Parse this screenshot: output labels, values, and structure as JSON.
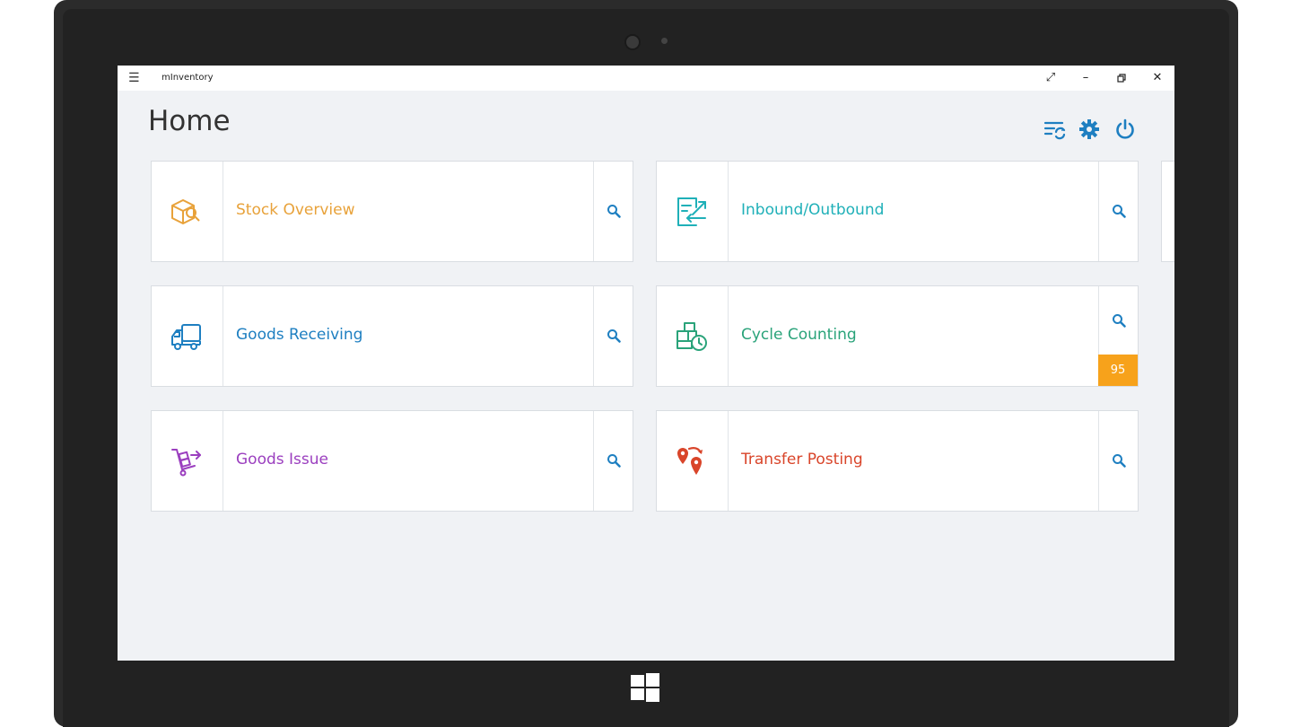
{
  "window": {
    "title": "mInventory"
  },
  "page": {
    "title": "Home"
  },
  "colors": {
    "accent": "#1e7fc1",
    "badge": "#f7a21b"
  },
  "header_icons": [
    "sync-settings-icon",
    "gear-icon",
    "power-icon"
  ],
  "tiles": [
    {
      "label": "Stock Overview",
      "color": "#e8a23a",
      "icon": "box-search-icon"
    },
    {
      "label": "Inbound/Outbound",
      "color": "#1fb0b8",
      "icon": "inbound-outbound-icon"
    },
    {
      "label": "Goods Receiving",
      "color": "#1e7fc1",
      "icon": "truck-icon"
    },
    {
      "label": "Cycle Counting",
      "color": "#2aa37a",
      "icon": "boxes-clock-icon",
      "badge": "95"
    },
    {
      "label": "Goods Issue",
      "color": "#9b3fbf",
      "icon": "hand-truck-icon"
    },
    {
      "label": "Transfer Posting",
      "color": "#d9452a",
      "icon": "location-pins-icon"
    }
  ]
}
